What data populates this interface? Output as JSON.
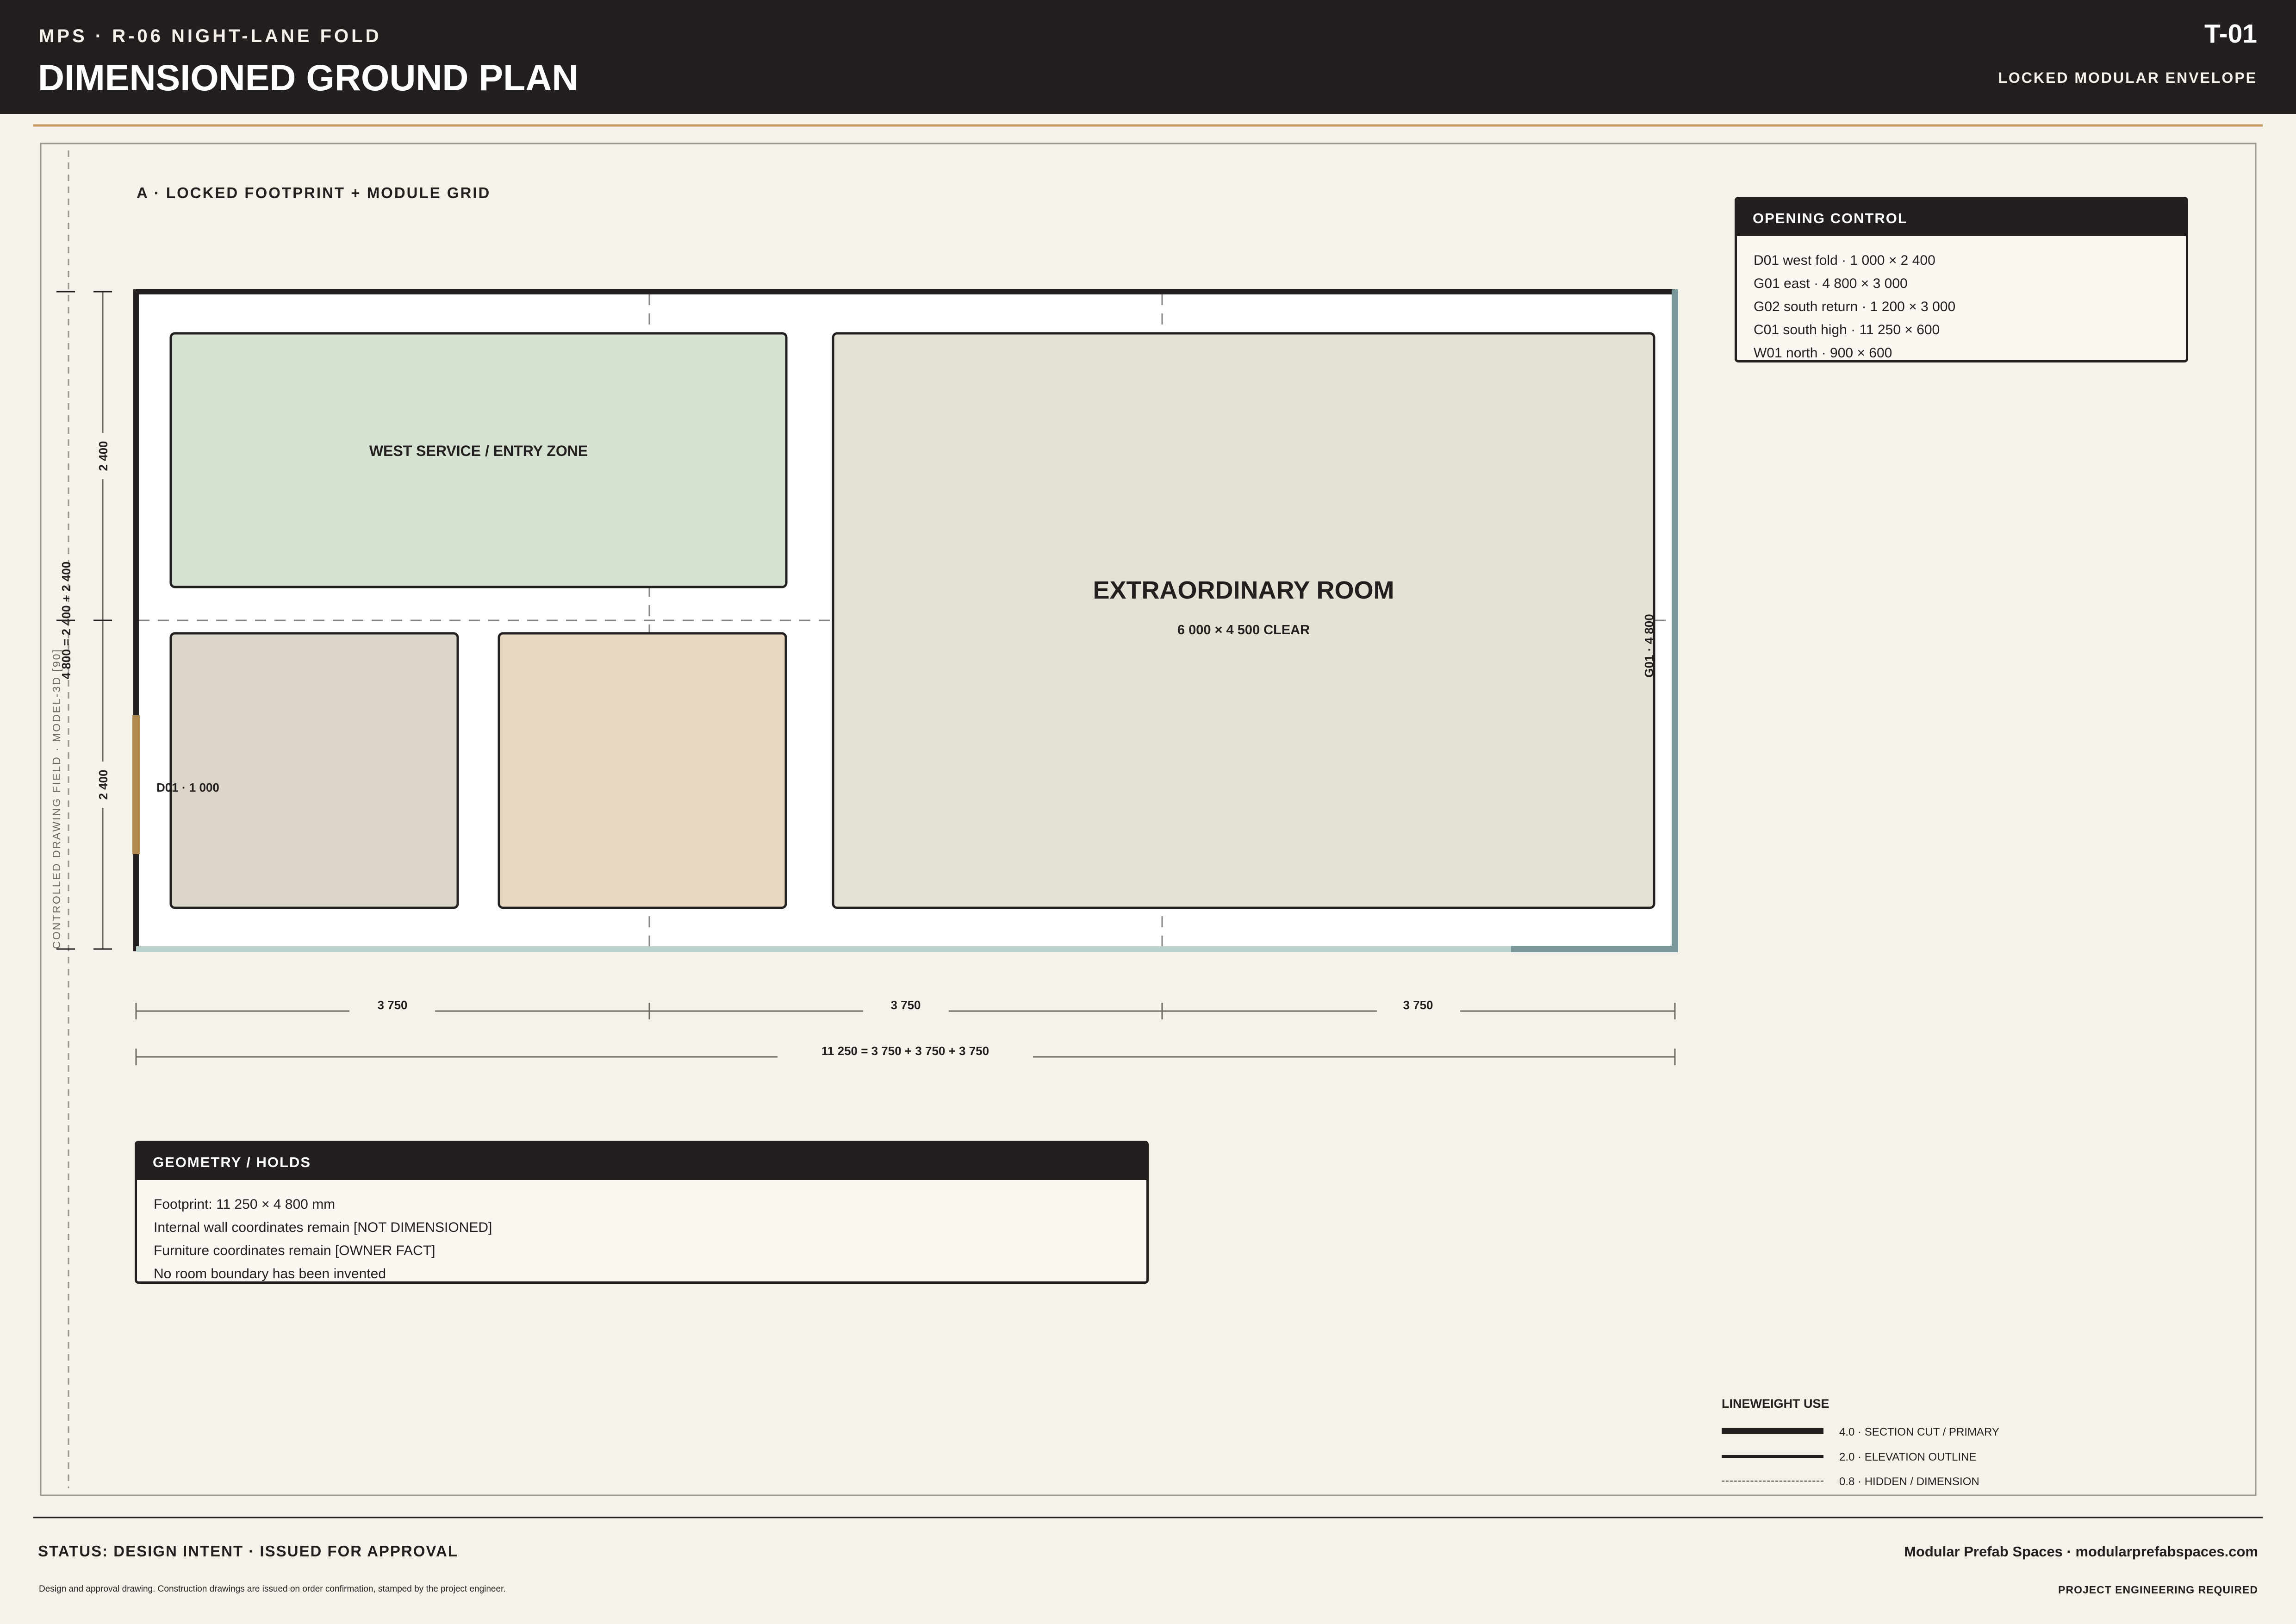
{
  "header": {
    "project": "MPS · R-06 NIGHT-LANE FOLD",
    "title": "DIMENSIONED GROUND PLAN",
    "sheet_no": "T-01",
    "envelope": "LOCKED MODULAR ENVELOPE"
  },
  "side_label": "CONTROLLED DRAWING FIELD · MODEL-3D [90]",
  "plan": {
    "section_title": "A · LOCKED FOOTPRINT + MODULE GRID",
    "rooms": {
      "west_service": "WEST SERVICE / ENTRY ZONE",
      "extraordinary": "EXTRAORDINARY ROOM",
      "extraordinary_clear": "6 000 × 4 500 CLEAR"
    },
    "labels": {
      "door_d01": "D01 · 1 000",
      "glazing_g01": "G01 · 4 800"
    },
    "dims": {
      "left_top": "2 400",
      "left_bottom": "2 400",
      "left_total": "4 800 = 2 400 + 2 400",
      "bay_1": "3 750",
      "bay_2": "3 750",
      "bay_3": "3 750",
      "overall": "11 250 = 3 750 + 3 750 + 3 750"
    },
    "colors": {
      "wall": "#231f1e",
      "glazing_east": "#7a989a",
      "glazing_south": "#b9d0cc",
      "door": "#b08a4e",
      "zone_green": "#d5e1d1",
      "zone_grey": "#dbd4c8",
      "zone_sand": "#e8d8bf",
      "zone_room": "#e6e1d5"
    }
  },
  "opening_control": {
    "title": "OPENING CONTROL",
    "items": [
      "D01 west fold · 1 000 × 2 400",
      "G01 east · 4 800 × 3 000",
      "G02 south return · 1 200 × 3 000",
      "C01 south high · 11 250 × 600",
      "W01 north · 900 × 600"
    ]
  },
  "geometry_holds": {
    "title": "GEOMETRY / HOLDS",
    "items": [
      "Footprint: 11 250 × 4 800 mm",
      "Internal wall coordinates remain [NOT DIMENSIONED]",
      "Furniture coordinates remain [OWNER FACT]",
      "No room boundary has been invented"
    ]
  },
  "lineweights": {
    "title": "LINEWEIGHT USE",
    "items": [
      {
        "label": "4.0 · SECTION CUT / PRIMARY",
        "weight": 4.0
      },
      {
        "label": "2.0 · ELEVATION OUTLINE",
        "weight": 2.0
      },
      {
        "label": "0.8 · HIDDEN / DIMENSION",
        "weight": 0.8
      }
    ]
  },
  "footer": {
    "status": "STATUS: DESIGN INTENT · ISSUED FOR APPROVAL",
    "disclaimer": "Design and approval drawing. Construction drawings are issued on order confirmation, stamped by the project engineer.",
    "company": "Modular Prefab Spaces · modularprefabspaces.com",
    "requirement": "PROJECT ENGINEERING REQUIRED"
  }
}
